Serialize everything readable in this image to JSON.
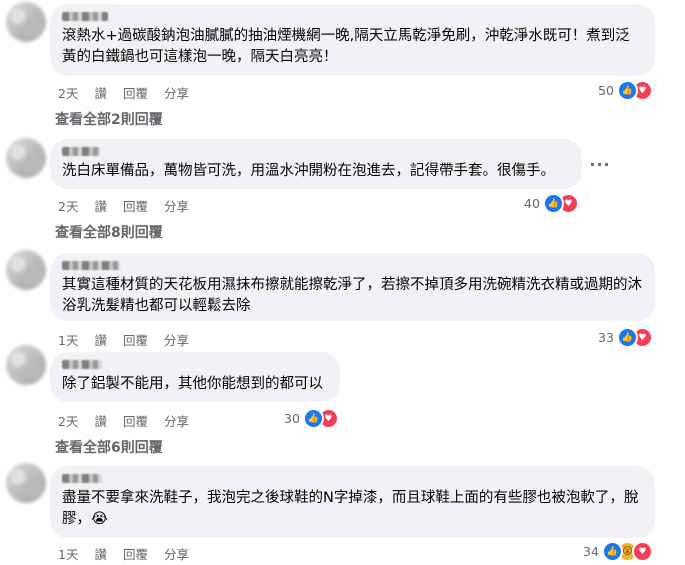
{
  "comments": [
    {
      "text": "滾熱水+過碳酸鈉泡油膩膩的抽油煙機網一晚,隔天立馬乾淨免刷，沖乾淨水既可！煮到泛黃的白鐵鍋也可這樣泡一晚，隔天白亮亮！",
      "time": "2天",
      "like_label": "讚",
      "reply_label": "回覆",
      "share_label": "分享",
      "reaction_count": "50",
      "reactions": [
        "like-icon",
        "love-icon"
      ],
      "view_replies": "查看全部2則回覆"
    },
    {
      "text": "洗白床單備品，萬物皆可洗，用溫水沖開粉在泡進去，記得帶手套。很傷手。",
      "time": "2天",
      "like_label": "讚",
      "reply_label": "回覆",
      "share_label": "分享",
      "reaction_count": "40",
      "reactions": [
        "like-icon",
        "love-icon"
      ],
      "view_replies": "查看全部8則回覆",
      "more_options": "···"
    },
    {
      "text": "其實這種材質的天花板用濕抹布擦就能擦乾淨了，若擦不掉頂多用洗碗精洗衣精或過期的沐浴乳洗髮精也都可以輕鬆去除",
      "time": "1天",
      "like_label": "讚",
      "reply_label": "回覆",
      "share_label": "分享",
      "reaction_count": "33",
      "reactions": [
        "like-icon",
        "love-icon"
      ]
    },
    {
      "text": "除了鋁製不能用，其他你能想到的都可以",
      "time": "2天",
      "like_label": "讚",
      "reply_label": "回覆",
      "share_label": "分享",
      "reaction_count": "30",
      "reactions": [
        "like-icon",
        "love-icon"
      ],
      "view_replies": "查看全部6則回覆"
    },
    {
      "text": "盡量不要拿來洗鞋子，我泡完之後球鞋的N字掉漆，而且球鞋上面的有些膠也被泡軟了，脫膠，😭",
      "time": "1天",
      "like_label": "讚",
      "reply_label": "回覆",
      "share_label": "分享",
      "reaction_count": "34",
      "reactions": [
        "like-icon",
        "wow-icon",
        "love-icon"
      ]
    }
  ]
}
